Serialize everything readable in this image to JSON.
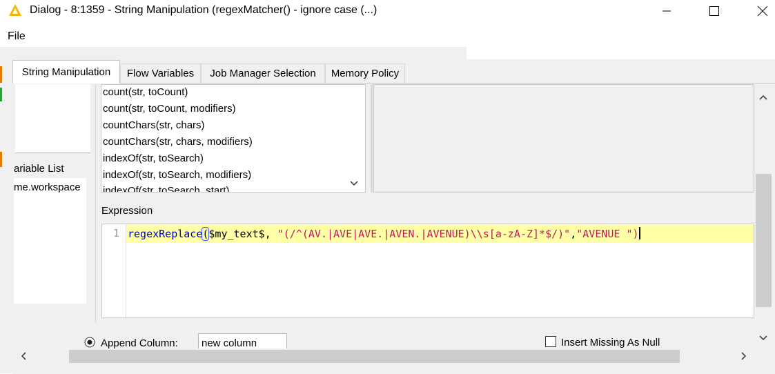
{
  "window": {
    "title": "Dialog - 8:1359 - String Manipulation (regexMatcher() - ignore case (...)",
    "minimize_label": "—",
    "maximize_label": "☐",
    "close_label": "✕"
  },
  "menu": {
    "file": "File"
  },
  "tabs": [
    {
      "label": "String Manipulation",
      "active": true
    },
    {
      "label": "Flow Variables"
    },
    {
      "label": "Job Manager Selection"
    },
    {
      "label": "Memory Policy"
    }
  ],
  "left_panel": {
    "variable_list_label": "ariable List",
    "variable_item": "me.workspace"
  },
  "functions": [
    "count(str, toCount)",
    "count(str, toCount, modifiers)",
    "countChars(str, chars)",
    "countChars(str, chars, modifiers)",
    "indexOf(str, toSearch)",
    "indexOf(str, toSearch, modifiers)",
    "indexOf(str, toSearch, start)"
  ],
  "expression": {
    "label": "Expression",
    "line_number": "1",
    "code_fn": "regexReplace",
    "code_paren_open": "(",
    "code_var": "$my_text$",
    "code_sep1": ", ",
    "code_str1": "\"(/^(AV.|AVE|AVE.|AVEN.|AVENUE)\\\\s[a-zA-Z]*$/)\"",
    "code_sep2": ",",
    "code_str2": "\"AVENUE \"",
    "code_paren_close": ")"
  },
  "bottom": {
    "append_column_label": "Append Column:",
    "append_column_value": "new column",
    "insert_missing_label": "Insert Missing As Null"
  },
  "colors": {
    "accent_icon": "#f2b705",
    "code_keyword": "#0000c0",
    "code_string": "#c2185b",
    "line_highlight": "#ffffa8"
  }
}
